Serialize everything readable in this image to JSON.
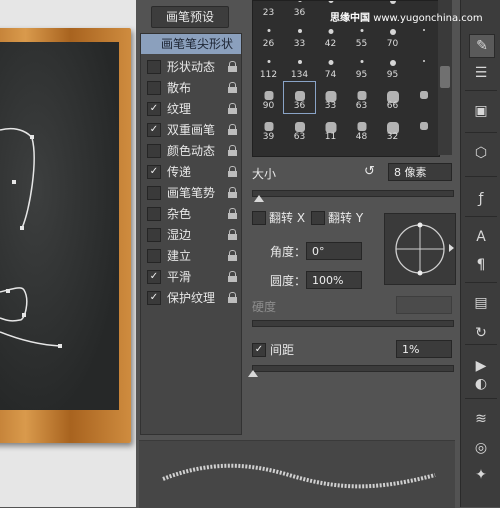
{
  "watermark": {
    "site": "思缘中国",
    "url": "www.yugonchina.com"
  },
  "presets_button": "画笔预设",
  "brush_options": [
    {
      "label": "画笔笔尖形状",
      "checked": null,
      "lock": false,
      "selected": true
    },
    {
      "label": "形状动态",
      "checked": false,
      "lock": true,
      "selected": false
    },
    {
      "label": "散布",
      "checked": false,
      "lock": true,
      "selected": false
    },
    {
      "label": "纹理",
      "checked": true,
      "lock": true,
      "selected": false
    },
    {
      "label": "双重画笔",
      "checked": true,
      "lock": true,
      "selected": false
    },
    {
      "label": "颜色动态",
      "checked": false,
      "lock": true,
      "selected": false
    },
    {
      "label": "传递",
      "checked": true,
      "lock": true,
      "selected": false
    },
    {
      "label": "画笔笔势",
      "checked": false,
      "lock": true,
      "selected": false
    },
    {
      "label": "杂色",
      "checked": false,
      "lock": true,
      "selected": false
    },
    {
      "label": "湿边",
      "checked": false,
      "lock": true,
      "selected": false
    },
    {
      "label": "建立",
      "checked": false,
      "lock": true,
      "selected": false
    },
    {
      "label": "平滑",
      "checked": true,
      "lock": true,
      "selected": false
    },
    {
      "label": "保护纹理",
      "checked": true,
      "lock": true,
      "selected": false
    }
  ],
  "brush_tips": [
    {
      "size": "23"
    },
    {
      "size": "36"
    },
    {
      "size": ""
    },
    {
      "size": ""
    },
    {
      "size": ""
    },
    {
      "size": ""
    },
    {
      "size": "26"
    },
    {
      "size": "33"
    },
    {
      "size": "42"
    },
    {
      "size": "55"
    },
    {
      "size": "70"
    },
    {
      "size": ""
    },
    {
      "size": "112"
    },
    {
      "size": "134"
    },
    {
      "size": "74"
    },
    {
      "size": "95"
    },
    {
      "size": "95"
    },
    {
      "size": ""
    },
    {
      "size": "90"
    },
    {
      "size": "36"
    },
    {
      "size": "33"
    },
    {
      "size": "63"
    },
    {
      "size": "66"
    },
    {
      "size": ""
    },
    {
      "size": "39"
    },
    {
      "size": "63"
    },
    {
      "size": "11"
    },
    {
      "size": "48"
    },
    {
      "size": "32"
    },
    {
      "size": ""
    }
  ],
  "selected_tip_index": 19,
  "size": {
    "label": "大小",
    "value": "8 像素"
  },
  "flip_x": {
    "label": "翻转 X",
    "checked": false
  },
  "flip_y": {
    "label": "翻转 Y",
    "checked": false
  },
  "angle": {
    "label": "角度：",
    "value": "0°"
  },
  "roundness": {
    "label": "圆度：",
    "value": "100%"
  },
  "hardness": {
    "label": "硬度",
    "value": ""
  },
  "spacing": {
    "label": "间距",
    "checked": true,
    "value": "1%"
  },
  "toolbar": {
    "icons": [
      "brush-icon",
      "brush-settings-icon",
      "clone-source-icon",
      "3d-cube-icon",
      "function-icon",
      "character-icon",
      "paragraph-icon",
      "properties-icon",
      "actions-icon",
      "play-icon",
      "adjustments-icon",
      "layers-icon",
      "channels-icon",
      "paths-icon"
    ]
  }
}
